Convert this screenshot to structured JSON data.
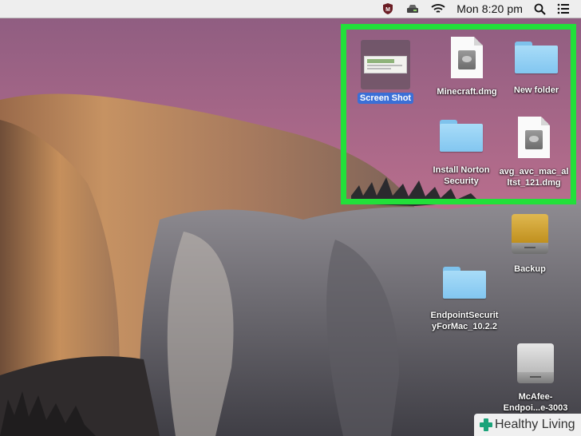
{
  "menubar": {
    "clock": "Mon 8:20 pm",
    "icons": [
      "mcafee-shield-icon",
      "drive-status-icon",
      "wifi-icon",
      "search-icon",
      "list-icon"
    ]
  },
  "desktop": {
    "items": [
      {
        "name": "Screen Shot",
        "type": "screenshot",
        "selected": true
      },
      {
        "name": "Minecraft.dmg",
        "type": "dmg"
      },
      {
        "name": "New folder",
        "type": "folder"
      },
      {
        "name": "Install Norton\nSecurity",
        "type": "folder"
      },
      {
        "name": "avg_avc_mac_al\nltst_121.dmg",
        "type": "dmg"
      },
      {
        "name": "Backup",
        "type": "drive-gold"
      },
      {
        "name": "EndpointSecurit\nyForMac_10.2.2",
        "type": "folder"
      },
      {
        "name": "McAfee-\nEndpoi...e-3003",
        "type": "drive-silver"
      }
    ]
  },
  "highlight": {
    "color": "#22e03a"
  },
  "watermark": {
    "brand": "Healthy Living"
  }
}
